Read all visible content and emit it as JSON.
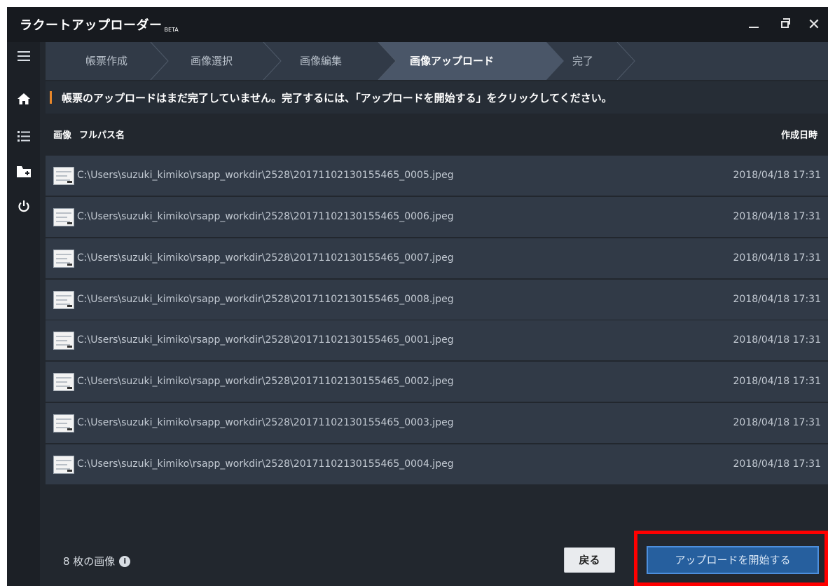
{
  "window": {
    "title": "ラクートアップローダー",
    "title_badge": "BETA",
    "minimize_label": "minimize",
    "maximize_label": "maximize",
    "close_label": "✕"
  },
  "sidebar": {
    "items": [
      {
        "icon": "menu-icon"
      },
      {
        "icon": "home-icon"
      },
      {
        "icon": "list-icon"
      },
      {
        "icon": "folder-add-icon"
      },
      {
        "icon": "power-icon"
      }
    ]
  },
  "steps": [
    {
      "label": "帳票作成",
      "active": false
    },
    {
      "label": "画像選択",
      "active": false
    },
    {
      "label": "画像編集",
      "active": false
    },
    {
      "label": "画像アップロード",
      "active": true
    },
    {
      "label": "完了",
      "active": false
    }
  ],
  "notice": {
    "text": "帳票のアップロードはまだ完了していません。完了するには、「アップロードを開始する」をクリックしてください。",
    "accent": "#e8872a"
  },
  "table": {
    "headers": {
      "image": "画像",
      "path": "フルパス名",
      "created": "作成日時"
    },
    "rows": [
      {
        "path": "C:\\Users\\suzuki_kimiko\\rsapp_workdir\\2528\\20171102130155465_0005.jpeg",
        "created": "2018/04/18 17:31"
      },
      {
        "path": "C:\\Users\\suzuki_kimiko\\rsapp_workdir\\2528\\20171102130155465_0006.jpeg",
        "created": "2018/04/18 17:31"
      },
      {
        "path": "C:\\Users\\suzuki_kimiko\\rsapp_workdir\\2528\\20171102130155465_0007.jpeg",
        "created": "2018/04/18 17:31"
      },
      {
        "path": "C:\\Users\\suzuki_kimiko\\rsapp_workdir\\2528\\20171102130155465_0008.jpeg",
        "created": "2018/04/18 17:31"
      },
      {
        "path": "C:\\Users\\suzuki_kimiko\\rsapp_workdir\\2528\\20171102130155465_0001.jpeg",
        "created": "2018/04/18 17:31"
      },
      {
        "path": "C:\\Users\\suzuki_kimiko\\rsapp_workdir\\2528\\20171102130155465_0002.jpeg",
        "created": "2018/04/18 17:31"
      },
      {
        "path": "C:\\Users\\suzuki_kimiko\\rsapp_workdir\\2528\\20171102130155465_0003.jpeg",
        "created": "2018/04/18 17:31"
      },
      {
        "path": "C:\\Users\\suzuki_kimiko\\rsapp_workdir\\2528\\20171102130155465_0004.jpeg",
        "created": "2018/04/18 17:31"
      }
    ]
  },
  "footer": {
    "count_label": "8 枚の画像",
    "info_icon": "i",
    "back_label": "戻る",
    "start_label": "アップロードを開始する",
    "highlight_color": "#ff0000"
  },
  "colors": {
    "background": "#22272e",
    "titlebar": "#171a1f",
    "row": "#313a47",
    "primary_button": "#265f9e"
  }
}
